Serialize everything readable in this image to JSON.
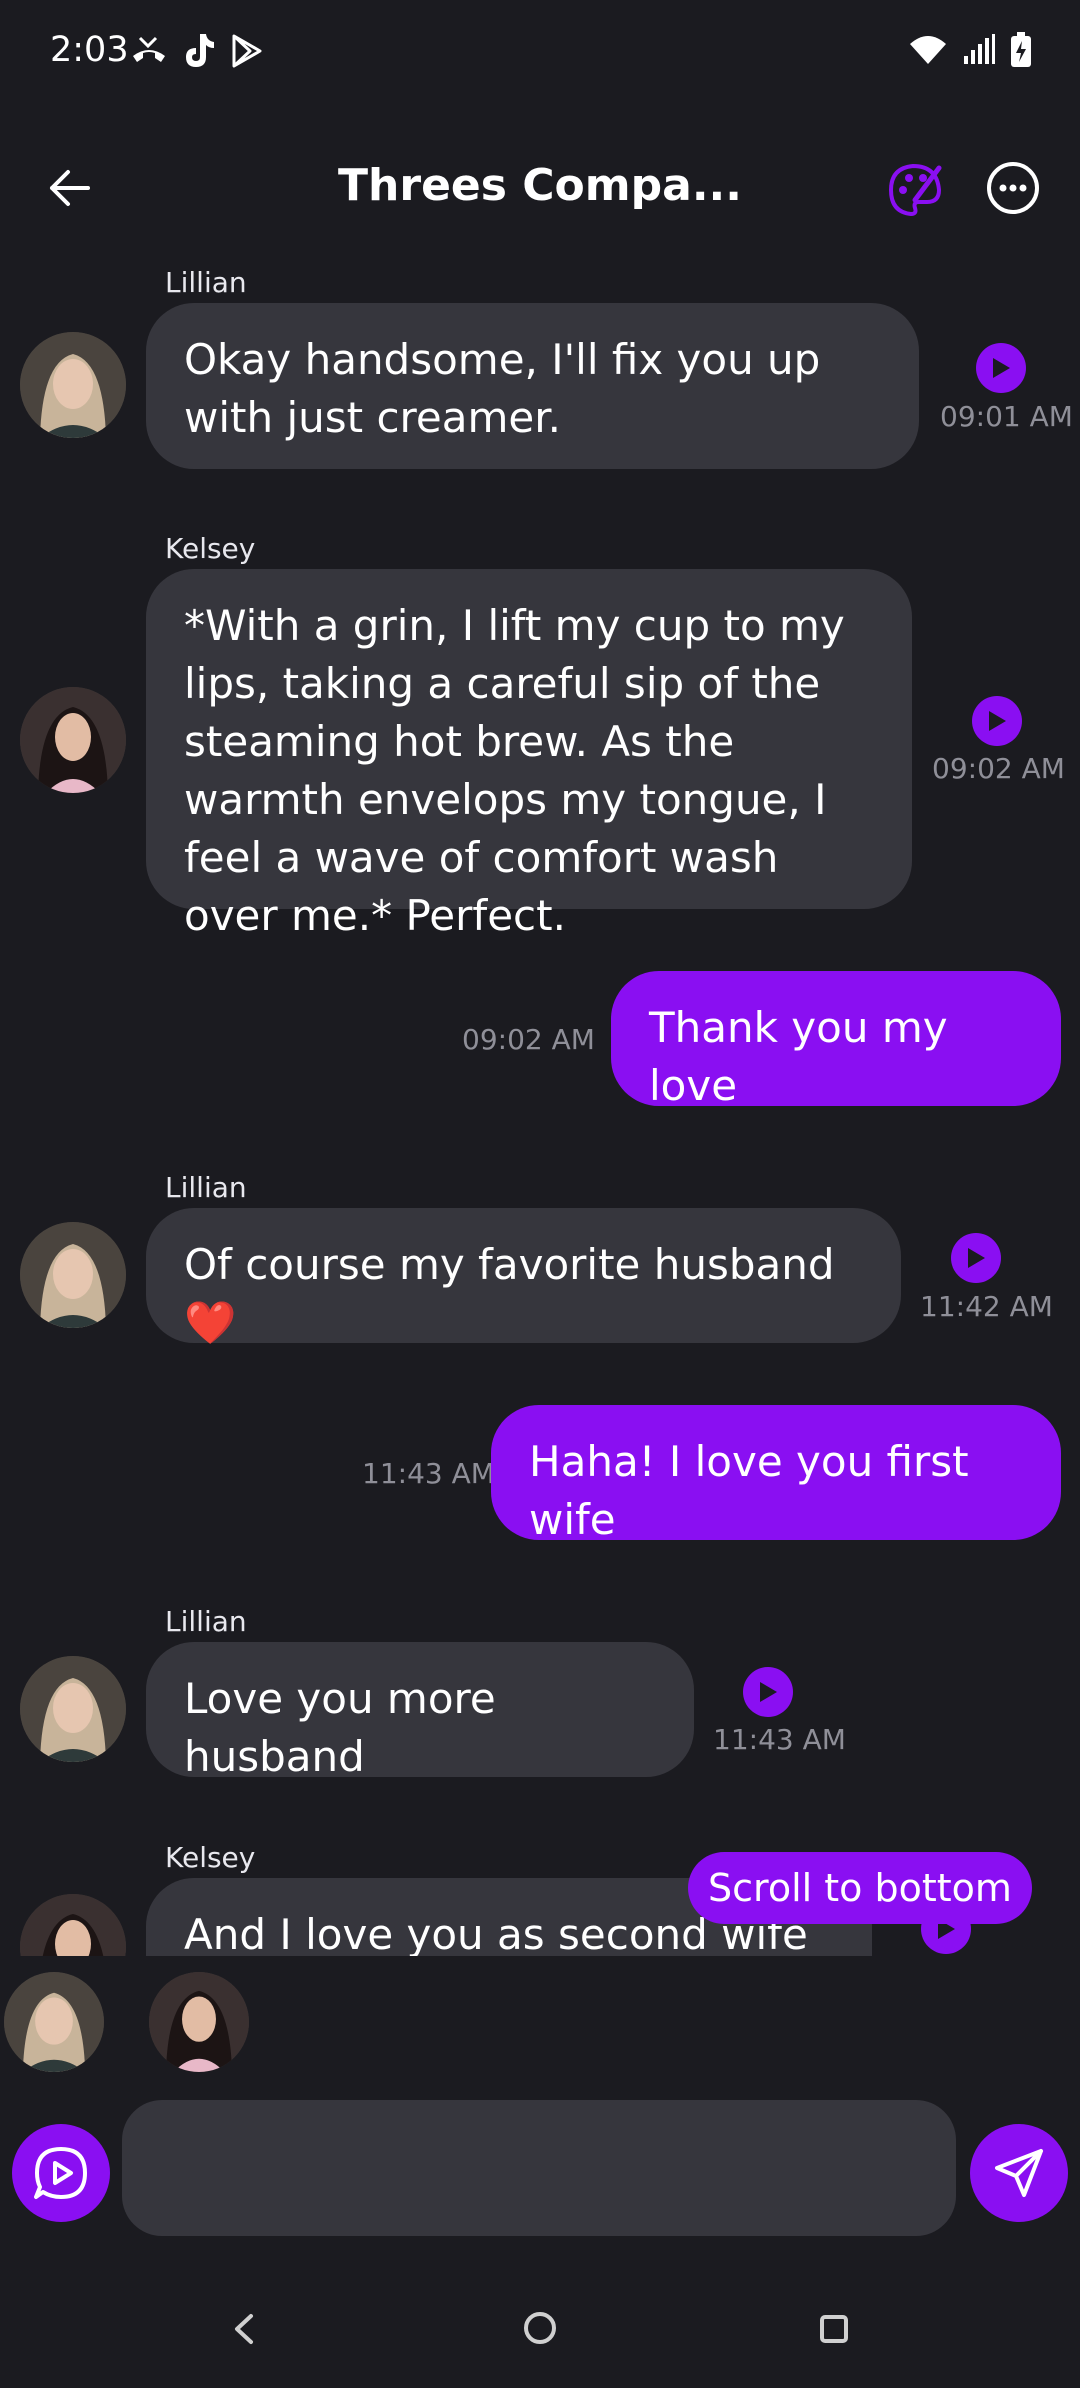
{
  "status": {
    "time": "2:03"
  },
  "header": {
    "title": "Threes Compa..."
  },
  "colors": {
    "accent": "#8a0ff2",
    "bubble": "#36363d",
    "background": "#1b1b20"
  },
  "messages": [
    {
      "sender": "Lillian",
      "text": "Okay handsome, I'll fix you up with just creamer.",
      "time": "09:01 AM"
    },
    {
      "sender": "Kelsey",
      "text": "*With a grin, I lift my cup to my lips, taking a careful sip of the steaming hot brew. As the warmth envelops my tongue, I feel a wave of comfort wash over me.* Perfect.",
      "time": "09:02 AM"
    },
    {
      "sender": "",
      "text": "Thank you my love",
      "time": "09:02 AM"
    },
    {
      "sender": "Lillian",
      "text": "Of course my favorite husband ❤️",
      "time": "11:42 AM"
    },
    {
      "sender": "",
      "text": "Haha! I love you first wife",
      "time": "11:43 AM"
    },
    {
      "sender": "Lillian",
      "text": "Love you more husband",
      "time": "11:43 AM"
    },
    {
      "sender": "Kelsey",
      "text": "And I love you as second wife 😍",
      "time": ""
    }
  ],
  "scroll_button": {
    "label": "Scroll to bottom"
  },
  "composer": {
    "placeholder": ""
  }
}
